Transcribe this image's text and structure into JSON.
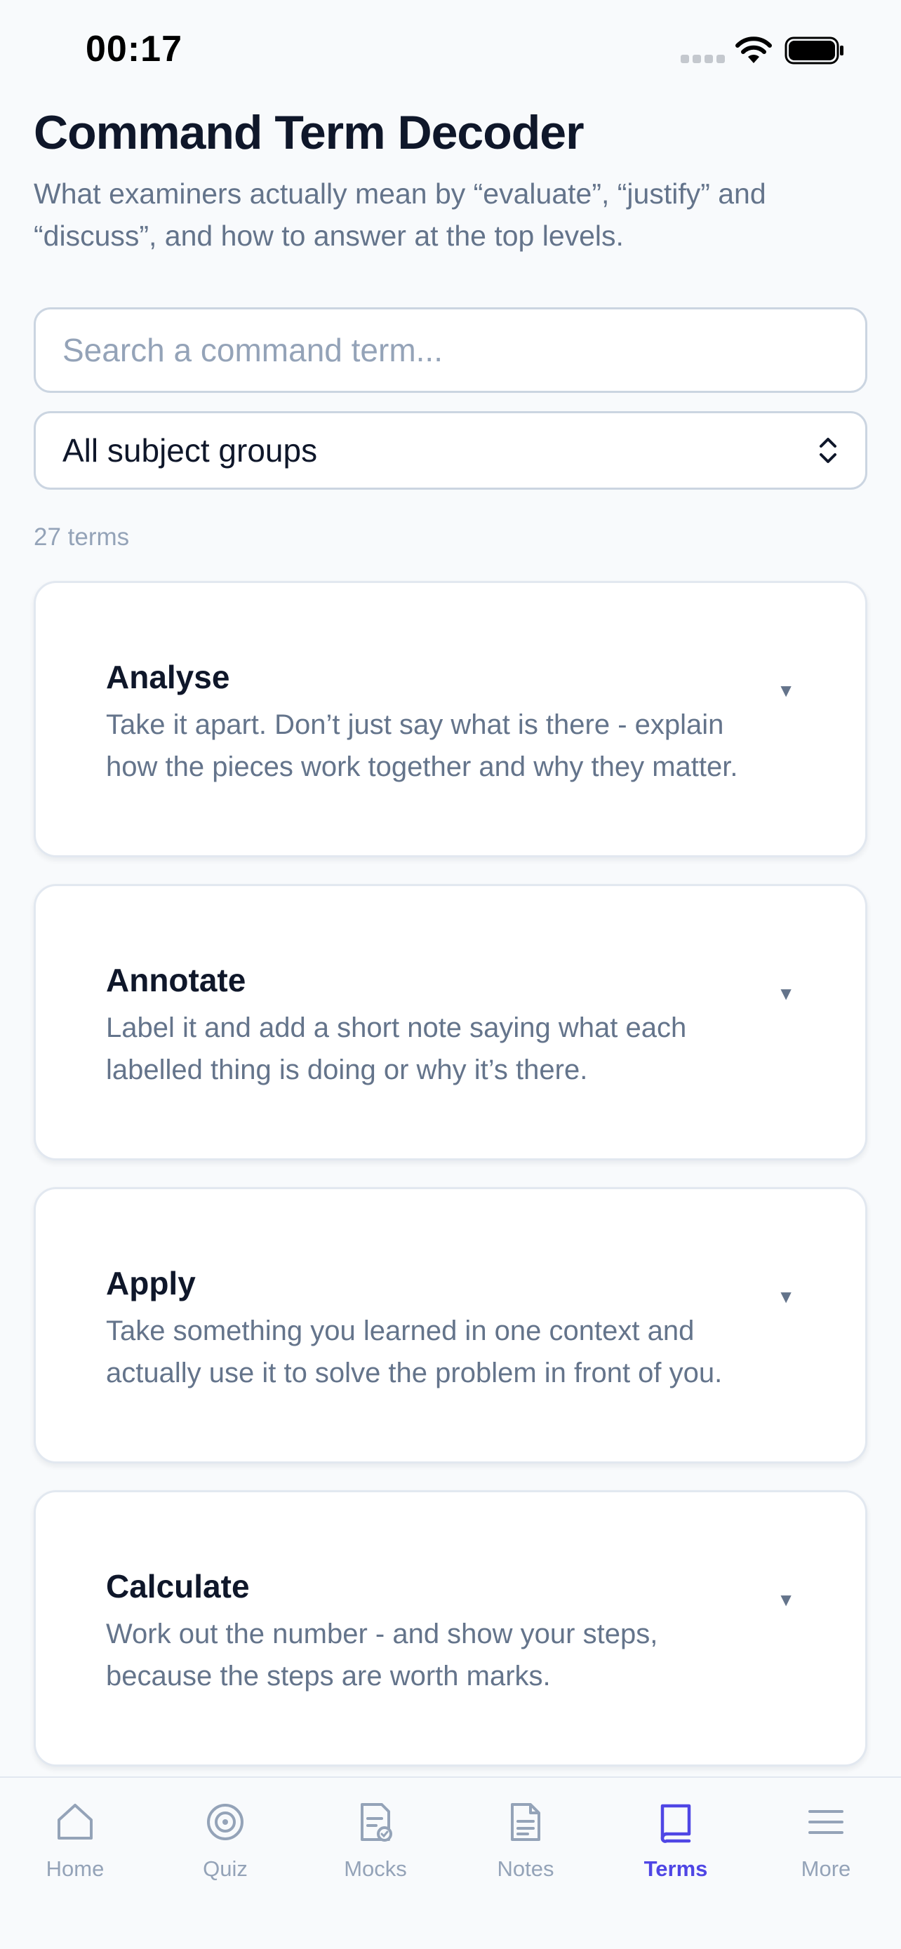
{
  "status": {
    "time": "00:17"
  },
  "header": {
    "title": "Command Term Decoder",
    "subtitle": "What examiners actually mean by “evaluate”, “justify” and “discuss”, and how to answer at the top levels."
  },
  "search": {
    "placeholder": "Search a command term...",
    "value": ""
  },
  "filter": {
    "selected": "All subject groups"
  },
  "count_label": "27 terms",
  "terms": [
    {
      "name": "Analyse",
      "description": "Take it apart. Don’t just say what is there - explain how the pieces work together and why they matter."
    },
    {
      "name": "Annotate",
      "description": "Label it and add a short note saying what each labelled thing is doing or why it’s there."
    },
    {
      "name": "Apply",
      "description": "Take something you learned in one context and actually use it to solve the problem in front of you."
    },
    {
      "name": "Calculate",
      "description": "Work out the number - and show your steps, because the steps are worth marks."
    }
  ],
  "tabs": [
    {
      "label": "Home",
      "icon": "home-icon"
    },
    {
      "label": "Quiz",
      "icon": "target-icon"
    },
    {
      "label": "Mocks",
      "icon": "exam-doc-icon"
    },
    {
      "label": "Notes",
      "icon": "document-icon"
    },
    {
      "label": "Terms",
      "icon": "book-icon"
    },
    {
      "label": "More",
      "icon": "menu-icon"
    }
  ],
  "active_tab": "Terms",
  "colors": {
    "accent": "#4f46e5",
    "muted": "#94a3b8",
    "text": "#0f172a",
    "secondary": "#64748b"
  }
}
